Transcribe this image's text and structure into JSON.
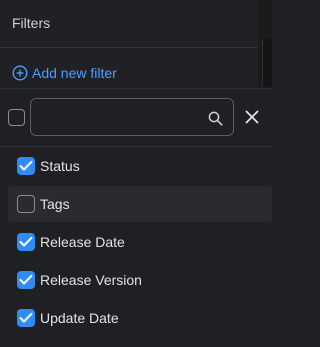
{
  "header": {
    "title": "Filters"
  },
  "add_filter": {
    "label": "Add new filter",
    "icon": "plus-circle-icon"
  },
  "search": {
    "value": "",
    "placeholder": "",
    "icon": "search-icon"
  },
  "close": {
    "icon": "close-icon"
  },
  "options": [
    {
      "label": "Status",
      "checked": true
    },
    {
      "label": "Tags",
      "checked": false
    },
    {
      "label": "Release Date",
      "checked": true
    },
    {
      "label": "Release Version",
      "checked": true
    },
    {
      "label": "Update Date",
      "checked": true
    }
  ],
  "colors": {
    "accent": "#2f8cf5",
    "link": "#4a9eff",
    "background": "#202124"
  }
}
